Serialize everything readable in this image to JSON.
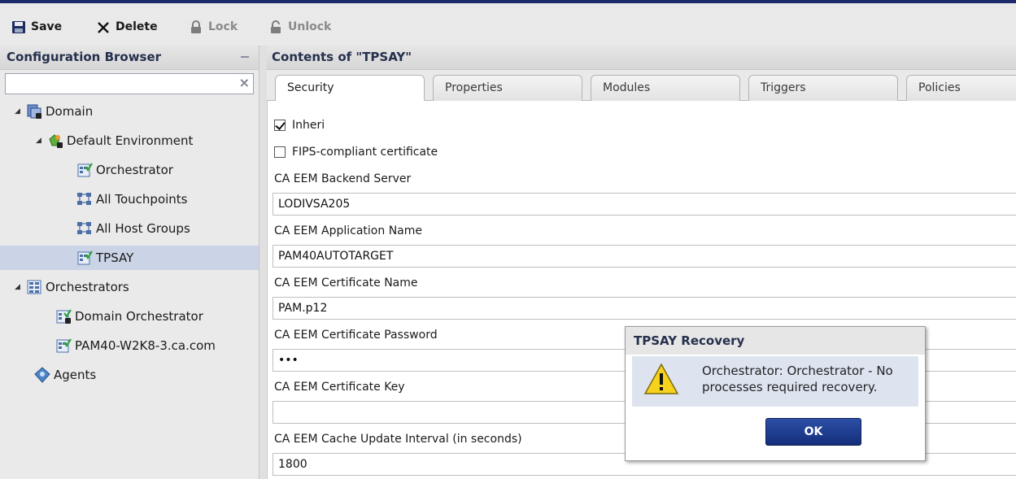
{
  "toolbar": {
    "save_label": "Save",
    "delete_label": "Delete",
    "lock_label": "Lock",
    "unlock_label": "Unlock"
  },
  "left_panel": {
    "title": "Configuration Browser",
    "filter_value": "",
    "tree": [
      {
        "label": "Domain",
        "icon": "domain-icon",
        "expanded": true
      },
      {
        "label": "Default Environment",
        "icon": "environment-icon",
        "expanded": true
      },
      {
        "label": "Orchestrator",
        "icon": "orchestrator-icon"
      },
      {
        "label": "All Touchpoints",
        "icon": "touchpoints-icon"
      },
      {
        "label": "All Host Groups",
        "icon": "host-groups-icon"
      },
      {
        "label": "TPSAY",
        "icon": "orchestrator-icon",
        "selected": true
      },
      {
        "label": "Orchestrators",
        "icon": "orchestrators-icon",
        "expanded": true
      },
      {
        "label": "Domain Orchestrator",
        "icon": "domain-orchestrator-icon"
      },
      {
        "label": "PAM40-W2K8-3.ca.com",
        "icon": "orchestrator-icon"
      },
      {
        "label": "Agents",
        "icon": "agents-icon"
      }
    ]
  },
  "right_panel": {
    "title": "Contents of \"TPSAY\"",
    "tabs": [
      {
        "label": "Security",
        "active": true
      },
      {
        "label": "Properties"
      },
      {
        "label": "Modules"
      },
      {
        "label": "Triggers"
      },
      {
        "label": "Policies"
      }
    ],
    "inherit_label": "Inheri",
    "inherit_checked": true,
    "fips_label": "FIPS-compliant certificate",
    "fips_checked": false,
    "fields": [
      {
        "label": "CA EEM Backend Server",
        "value": "LODIVSA205"
      },
      {
        "label": "CA EEM Application Name",
        "value": "PAM40AUTOTARGET"
      },
      {
        "label": "CA EEM Certificate Name",
        "value": "PAM.p12"
      },
      {
        "label": "CA EEM Certificate Password",
        "value": "•••"
      },
      {
        "label": "CA EEM Certificate Key",
        "value": ""
      },
      {
        "label": "CA EEM Cache Update Interval (in seconds)",
        "value": "1800"
      }
    ]
  },
  "dialog": {
    "title": "TPSAY Recovery",
    "message": "Orchestrator: Orchestrator - No processes required recovery.",
    "ok_label": "OK"
  },
  "colors": {
    "accent": "#1b2a6b",
    "selection": "#cbd3e6",
    "button": "#1f3d92"
  }
}
